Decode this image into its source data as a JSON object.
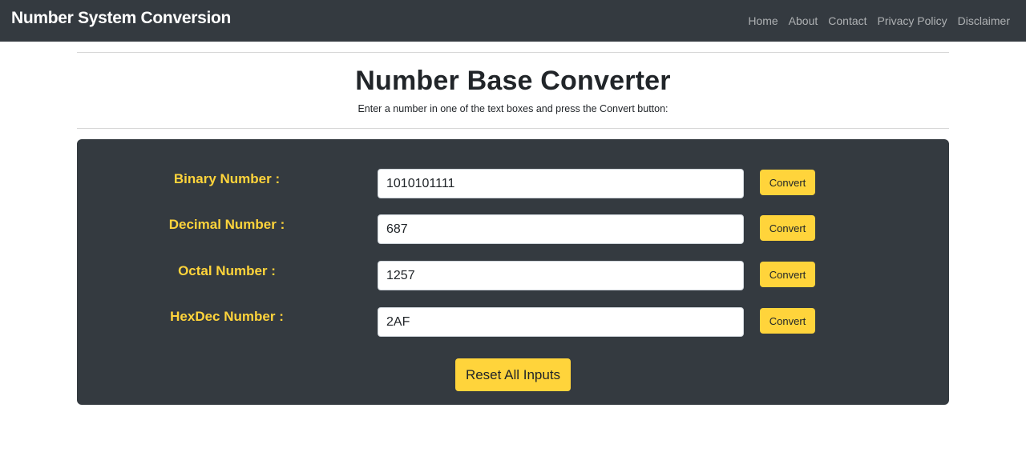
{
  "navbar": {
    "brand": "Number System Conversion",
    "links": [
      "Home",
      "About",
      "Contact",
      "Privacy Policy",
      "Disclaimer"
    ]
  },
  "header": {
    "title": "Number Base Converter",
    "subtitle": "Enter a number in one of the text boxes and press the Convert button:"
  },
  "converter": {
    "rows": [
      {
        "label": "Binary Number :",
        "value": "1010101111",
        "button": "Convert"
      },
      {
        "label": "Decimal Number :",
        "value": "687",
        "button": "Convert"
      },
      {
        "label": "Octal Number :",
        "value": "1257",
        "button": "Convert"
      },
      {
        "label": "HexDec Number :",
        "value": "2AF",
        "button": "Convert"
      }
    ],
    "reset_label": "Reset All Inputs"
  },
  "colors": {
    "navbar_bg": "#343a40",
    "panel_bg": "#343a40",
    "accent": "#ffd43b"
  }
}
